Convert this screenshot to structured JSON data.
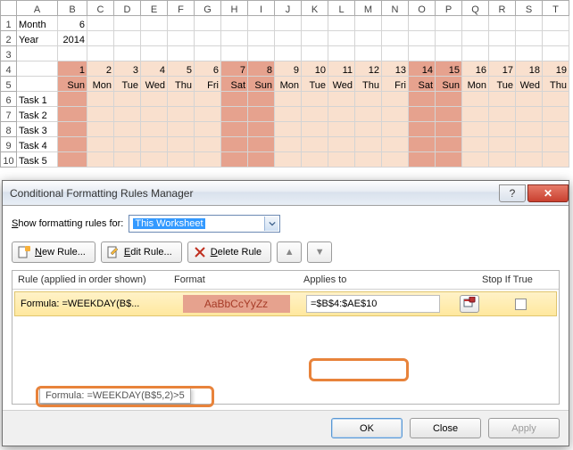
{
  "sheet": {
    "columns": [
      "A",
      "B",
      "C",
      "D",
      "E",
      "F",
      "G",
      "H",
      "I",
      "J",
      "K",
      "L",
      "M",
      "N",
      "O",
      "P",
      "Q",
      "R",
      "S",
      "T"
    ],
    "rows": [
      "1",
      "2",
      "3",
      "4",
      "5",
      "6",
      "7",
      "8",
      "9",
      "10"
    ],
    "a1": "Month",
    "b1": "6",
    "a2": "Year",
    "b2": "2014",
    "days": [
      "1",
      "2",
      "3",
      "4",
      "5",
      "6",
      "7",
      "8",
      "9",
      "10",
      "11",
      "12",
      "13",
      "14",
      "15",
      "16",
      "17",
      "18",
      "19"
    ],
    "weekdays": [
      "Sun",
      "Mon",
      "Tue",
      "Wed",
      "Thu",
      "Fri",
      "Sat",
      "Sun",
      "Mon",
      "Tue",
      "Wed",
      "Thu",
      "Fri",
      "Sat",
      "Sun",
      "Mon",
      "Tue",
      "Wed",
      "Thu"
    ],
    "is_wkend": [
      true,
      false,
      false,
      false,
      false,
      false,
      true,
      true,
      false,
      false,
      false,
      false,
      false,
      true,
      true,
      false,
      false,
      false,
      false
    ],
    "tasks": [
      "Task 1",
      "Task 2",
      "Task 3",
      "Task 4",
      "Task 5"
    ]
  },
  "dialog": {
    "title": "Conditional Formatting Rules Manager",
    "show_label": "Show formatting rules for:",
    "show_value": "This Worksheet",
    "buttons": {
      "new": "New Rule...",
      "edit": "Edit Rule...",
      "delete": "Delete Rule"
    },
    "headers": {
      "rule": "Rule (applied in order shown)",
      "format": "Format",
      "applies": "Applies to",
      "stop": "Stop If True"
    },
    "rule1": {
      "label": "Formula: =WEEKDAY(B$...",
      "preview": "AaBbCcYyZz",
      "applies": "=$B$4:$AE$10"
    },
    "tooltip": "Formula: =WEEKDAY(B$5,2)>5",
    "footer": {
      "ok": "OK",
      "close": "Close",
      "apply": "Apply"
    },
    "help_glyph": "?",
    "close_glyph": "✕"
  }
}
